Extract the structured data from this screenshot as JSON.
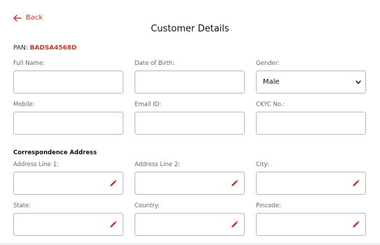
{
  "header": {
    "back_label": "Back",
    "title": "Customer Details"
  },
  "pan": {
    "label": "PAN:",
    "value": "BADSA4568D"
  },
  "personal": {
    "full_name": {
      "label": "Full Name:",
      "value": ""
    },
    "dob": {
      "label": "Date of Birth:",
      "value": ""
    },
    "gender": {
      "label": "Gender:",
      "selected": "Male"
    },
    "mobile": {
      "label": "Mobile:",
      "value": ""
    },
    "email": {
      "label": "Email ID:",
      "value": ""
    },
    "ckyc": {
      "label": "CKYC No.:",
      "value": ""
    }
  },
  "address": {
    "heading": "Correspondence Address",
    "line1": {
      "label": "Address Line 1:",
      "value": ""
    },
    "line2": {
      "label": "Address Line 2:",
      "value": ""
    },
    "city": {
      "label": "City:",
      "value": ""
    },
    "state": {
      "label": "State:",
      "value": ""
    },
    "country": {
      "label": "Country:",
      "value": ""
    },
    "pincode": {
      "label": "Pincode:",
      "value": ""
    }
  },
  "colors": {
    "accent": "#c0392b",
    "border": "#b9b9b9",
    "label": "#666666"
  },
  "icons": {
    "back": "arrow-left-icon",
    "edit": "pencil-icon",
    "dropdown": "chevron-down-icon"
  }
}
